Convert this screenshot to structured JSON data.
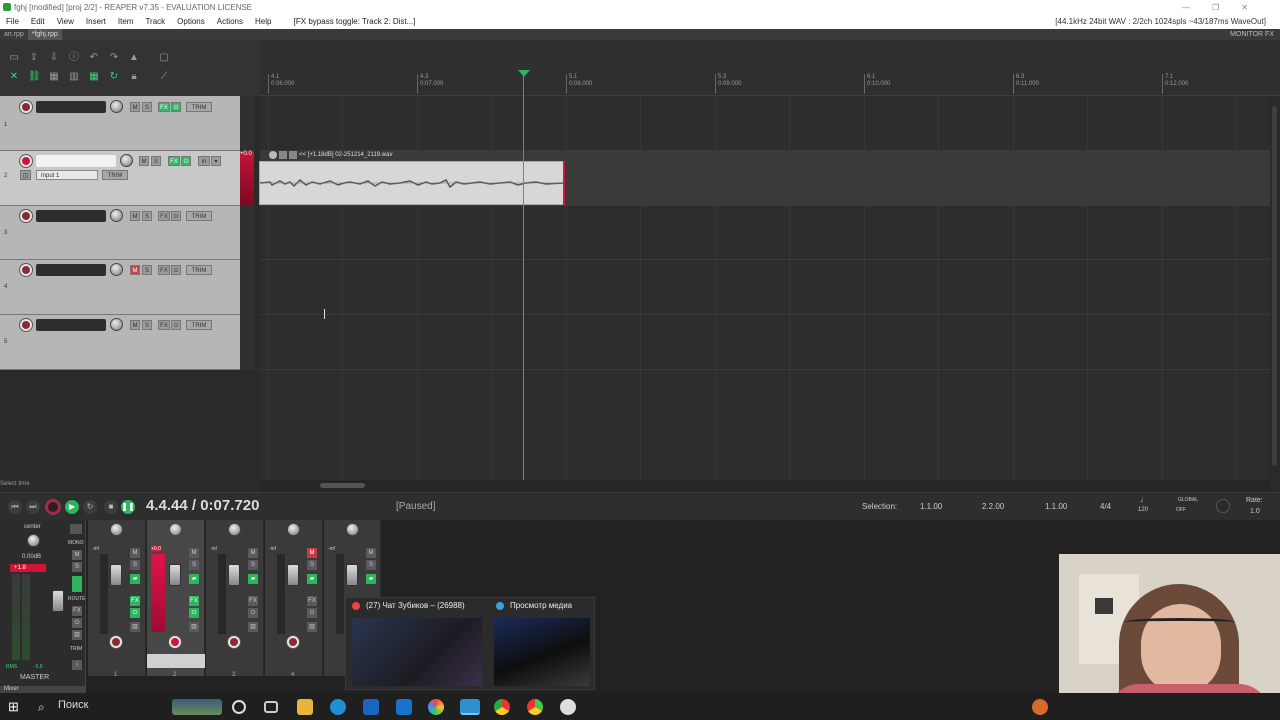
{
  "window": {
    "title": "fghj [modified] [proj 2/2] - REAPER v7.35 - EVALUATION LICENSE",
    "status_right": "[44.1kHz 24bit WAV : 2/2ch 1024spls ~43/187ms WaveOut]",
    "controls": [
      "—",
      "❐",
      "✕"
    ]
  },
  "menu": {
    "items": [
      "File",
      "Edit",
      "View",
      "Insert",
      "Item",
      "Track",
      "Options",
      "Actions",
      "Help"
    ],
    "hint": "[FX bypass toggle: Track 2: Dist...]"
  },
  "tabs": [
    {
      "label": "ап.rpp",
      "active": false
    },
    {
      "label": "*fghj.rpp",
      "active": true
    }
  ],
  "monitor_fx": "MONITOR FX",
  "ruler": {
    "marks": [
      {
        "bar": "4.1",
        "time": "0:06.000"
      },
      {
        "bar": "4.3",
        "time": "0:07.000"
      },
      {
        "bar": "5.1",
        "time": "0:08.000"
      },
      {
        "bar": "5.3",
        "time": "0:09.000"
      },
      {
        "bar": "6.1",
        "time": "0:10.000"
      },
      {
        "bar": "6.3",
        "time": "0:11.000"
      },
      {
        "bar": "7.1",
        "time": "0:12.000"
      }
    ]
  },
  "tracks": [
    {
      "num": "1",
      "armed": false,
      "mute": false,
      "selected": false,
      "fx_label": "FX",
      "trim_label": "TRIM"
    },
    {
      "num": "2",
      "armed": true,
      "mute": false,
      "selected": true,
      "fx_label": "FX",
      "trim_label": "TRIM",
      "input_label": "Input 1",
      "meter_label": "+0.0"
    },
    {
      "num": "3",
      "armed": false,
      "mute": false,
      "selected": false,
      "fx_label": "FX",
      "trim_label": "TRIM"
    },
    {
      "num": "4",
      "armed": false,
      "mute": true,
      "selected": false,
      "fx_label": "FX",
      "trim_label": "TRIM"
    },
    {
      "num": "5",
      "armed": false,
      "mute": false,
      "selected": false,
      "fx_label": "FX",
      "trim_label": "TRIM"
    }
  ],
  "track_buttons": {
    "m": "M",
    "s": "S",
    "in": "in"
  },
  "item": {
    "name": "<< [+1.18dB] 02-251214_2119.wav"
  },
  "select_hint": "Select time",
  "transport": {
    "position": "4.4.44 / 0:07.720",
    "state": "[Paused]",
    "selection_label": "Selection:",
    "sel_start": "1.1.00",
    "sel_end": "2.2.00",
    "sel_length": "1.1.00",
    "time_sig": "4/4",
    "tempo": "120",
    "global_label": "GLOBAL",
    "global_state": "OFF",
    "rate_label": "Rate:",
    "rate_value": "1.0"
  },
  "mixer": {
    "master_label": "MASTER",
    "mixer_tab": "Mixer",
    "pan_label": "center",
    "master_db": "0.00dB",
    "master_peak": "+1.8",
    "rms_label": "RMS",
    "rms_value": "-5.6",
    "mono_label": "MONO",
    "route_label": "ROUTE",
    "trim_label": "TRIM",
    "strip_numbers": [
      "1",
      "2",
      "3",
      "4",
      "5"
    ],
    "strip_peaks": [
      "-inf",
      "+0.0",
      "-inf",
      "-inf",
      "-inf"
    ]
  },
  "taskbar": {
    "search_placeholder": "Поиск",
    "thumbnails": [
      {
        "title": "(27) Чат Зубиков – (26988)"
      },
      {
        "title": "Просмотр медиа"
      }
    ]
  },
  "colors": {
    "accent_green": "#2bb55d",
    "record_red": "#d3143a",
    "mute_red": "#c53a44",
    "track_bg": "#b6b6b6"
  }
}
